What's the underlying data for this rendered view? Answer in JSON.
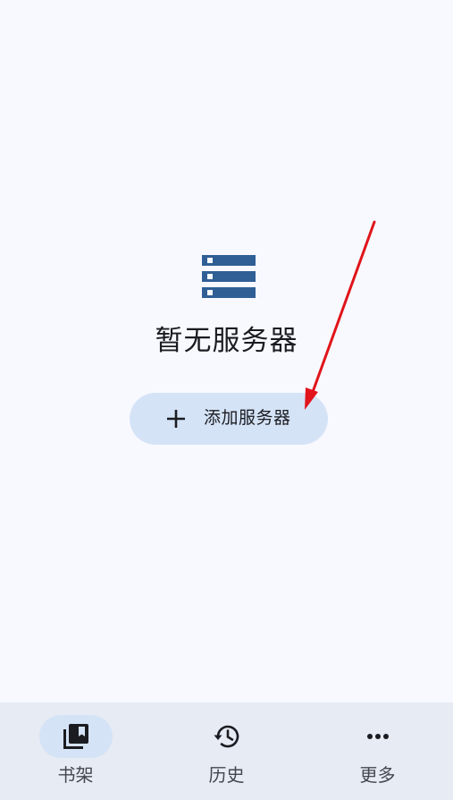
{
  "empty_state": {
    "icon": "server-stack-icon",
    "title": "暂无服务器"
  },
  "add_button": {
    "icon": "plus-icon",
    "label": "添加服务器"
  },
  "bottom_nav": {
    "items": [
      {
        "label": "书架",
        "icon": "bookshelf-icon",
        "active": true
      },
      {
        "label": "历史",
        "icon": "history-icon",
        "active": false
      },
      {
        "label": "更多",
        "icon": "more-horiz-icon",
        "active": false
      }
    ]
  },
  "colors": {
    "background": "#f8f9ff",
    "primary_icon": "#2f5f94",
    "button_container": "#d5e3f7",
    "nav_background": "#e7ebf4",
    "annotation_arrow": "#e0141a"
  }
}
